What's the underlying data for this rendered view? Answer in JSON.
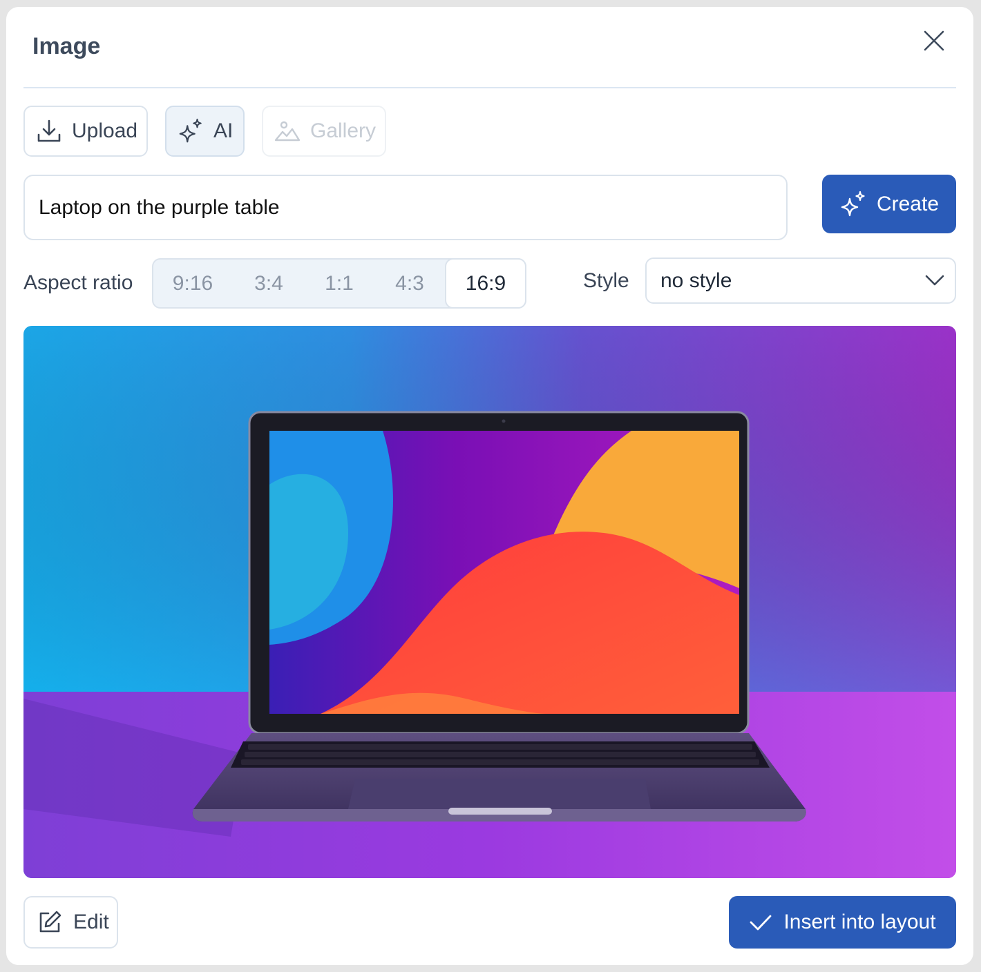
{
  "dialog": {
    "title": "Image",
    "close_icon": "close-icon"
  },
  "tabs": [
    {
      "label": "Upload",
      "icon": "download-icon",
      "state": "default"
    },
    {
      "label": "AI",
      "icon": "sparkles-icon",
      "state": "selected"
    },
    {
      "label": "Gallery",
      "icon": "image-icon",
      "state": "disabled"
    }
  ],
  "prompt": {
    "value": "Laptop on the purple table",
    "create_label": "Create",
    "create_icon": "sparkles-icon"
  },
  "aspect_ratio": {
    "label": "Aspect ratio",
    "options": [
      "9:16",
      "3:4",
      "1:1",
      "4:3",
      "16:9"
    ],
    "selected": "16:9"
  },
  "style": {
    "label": "Style",
    "value": "no style"
  },
  "footer": {
    "edit_label": "Edit",
    "edit_icon": "edit-icon",
    "insert_label": "Insert into layout",
    "insert_icon": "check-icon"
  },
  "colors": {
    "primary": "#2a5bb8",
    "border": "#dbe3ec",
    "selected_bg": "#edf3f9",
    "title_text": "#3d4a5c"
  }
}
